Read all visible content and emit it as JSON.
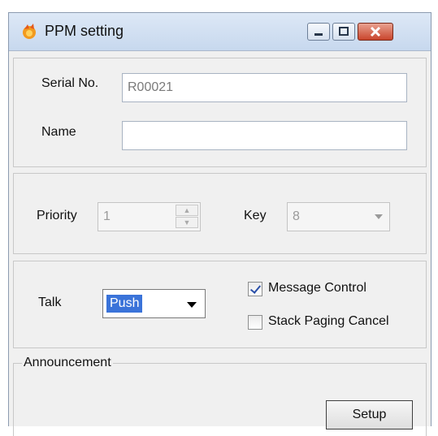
{
  "window": {
    "title": "PPM setting",
    "icons": {
      "app": "app-flame-icon",
      "minimize": "minimize-icon",
      "maximize": "maximize-icon",
      "close": "close-icon"
    }
  },
  "identity": {
    "serial_label": "Serial No.",
    "serial_value": "R00021",
    "name_label": "Name",
    "name_value": ""
  },
  "priority_group": {
    "priority_label": "Priority",
    "priority_value": "1",
    "key_label": "Key",
    "key_value": "8"
  },
  "talk_group": {
    "talk_label": "Talk",
    "talk_value": "Push",
    "message_control_label": "Message Control",
    "message_control_checked": true,
    "stack_paging_cancel_label": "Stack Paging Cancel",
    "stack_paging_cancel_checked": false
  },
  "announcement": {
    "legend": "Announcement",
    "setup_label": "Setup"
  },
  "colors": {
    "title_bar": "#c7d8ee",
    "selection": "#3a73d9",
    "close_button": "#c9452c"
  }
}
